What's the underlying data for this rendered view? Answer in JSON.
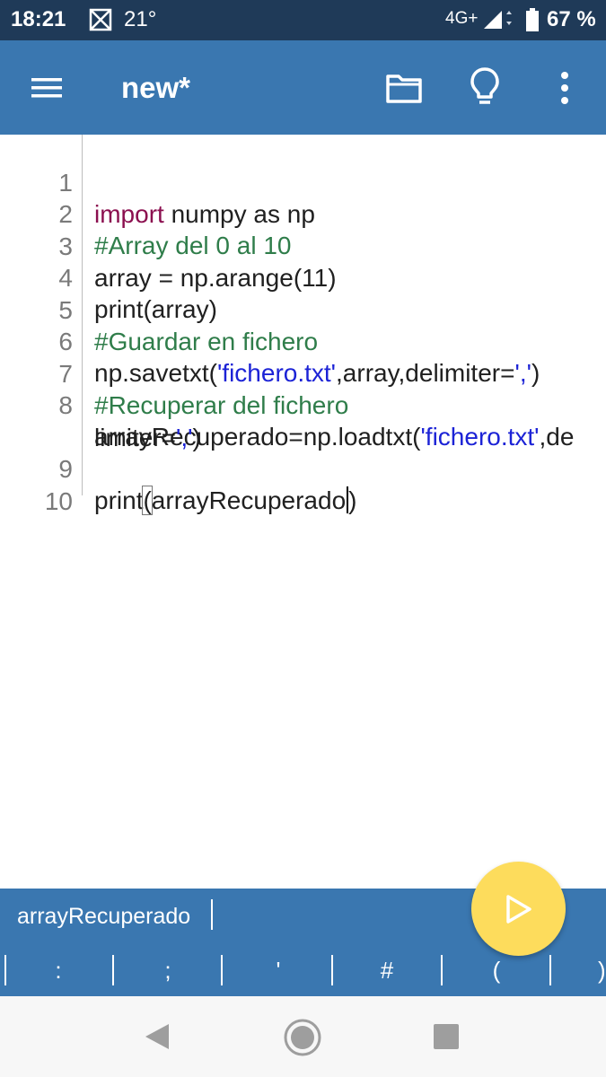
{
  "status": {
    "time": "18:21",
    "temperature": "21°",
    "network": "4G+",
    "battery": "67 %",
    "icons": [
      "notification-icon",
      "signal-icon",
      "battery-icon"
    ]
  },
  "app_bar": {
    "title": "new*",
    "icons": [
      "menu-icon",
      "folder-icon",
      "lightbulb-icon",
      "more-vert-icon"
    ]
  },
  "editor": {
    "line_numbers": [
      "1",
      "2",
      "3",
      "4",
      "5",
      "6",
      "7",
      "8",
      "9",
      "10"
    ],
    "lines": {
      "l1_kw": "import",
      "l1_rest": " numpy as np",
      "l2_comment": "#Array del 0 al 10",
      "l3": "array = np.arange(11)",
      "l4": "print(array)",
      "l5_comment": "#Guardar en fichero",
      "l6_a": "np.savetxt(",
      "l6_str1": "'fichero.txt'",
      "l6_b": ",array,delimiter=",
      "l6_str2": "','",
      "l6_c": ")",
      "l7_comment": "#Recuperar del fichero",
      "l8_a": "arrayRecuperado=np.loadtxt(",
      "l8_str1": "'fichero.txt'",
      "l8_b": ",de",
      "l8w_a": "limiter=",
      "l8w_str": "','",
      "l8w_b": ")",
      "l9_a": "print",
      "l9_paren": "(",
      "l9_b": "arrayRecuperado",
      "l9_close": ")"
    }
  },
  "suggestion": {
    "word": "arrayRecuperado"
  },
  "symbols": [
    ":",
    ";",
    "'",
    "#",
    "(",
    ")"
  ],
  "colors": {
    "status_bar": "#1f3a58",
    "app_bar": "#3a77b0",
    "keyword": "#8b0f4f",
    "comment": "#2f7d4a",
    "string": "#1c23d6",
    "run_button": "#fddc5c"
  }
}
